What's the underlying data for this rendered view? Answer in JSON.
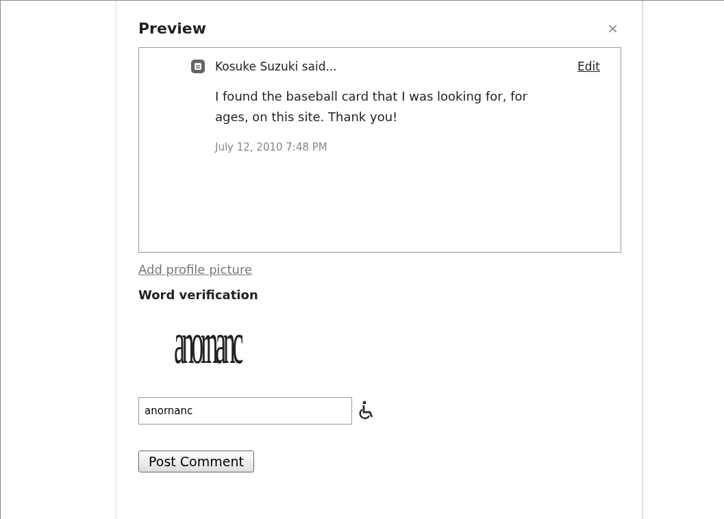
{
  "dialog": {
    "title": "Preview",
    "close": "×"
  },
  "comment": {
    "author": "Kosuke Suzuki",
    "said": "said...",
    "edit": "Edit",
    "body": "I found the baseball card that I was looking for, for ages, on this site. Thank you!",
    "timestamp": "July 12, 2010 7:48 PM"
  },
  "add_profile_picture": "Add profile picture",
  "word_verification": {
    "heading": "Word verification",
    "captcha": "anornanc",
    "value": "anornanc"
  },
  "submit": "Post Comment"
}
